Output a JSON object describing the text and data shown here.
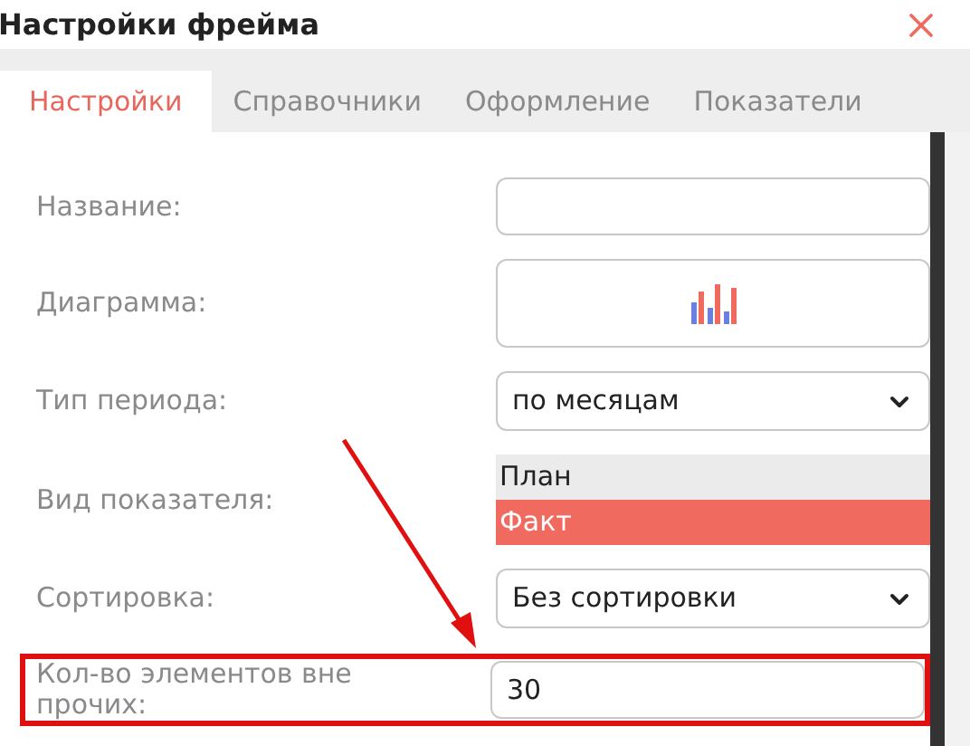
{
  "window": {
    "title": "Настройки фрейма"
  },
  "tabs": [
    {
      "label": "Настройки",
      "selected": true
    },
    {
      "label": "Справочники",
      "selected": false
    },
    {
      "label": "Оформление",
      "selected": false
    },
    {
      "label": "Показатели",
      "selected": false
    }
  ],
  "fields": [
    {
      "kind": "text",
      "label": "Название:",
      "highlighted": false
    },
    {
      "kind": "chart",
      "label": "Диаграмма:",
      "highlighted": false
    },
    {
      "kind": "select",
      "label": "Тип периода:",
      "value": "по месяцам",
      "highlighted": false
    },
    {
      "kind": "listbox",
      "label": "Вид показателя:",
      "options": [
        {
          "label": "План",
          "selected": false
        },
        {
          "label": "Факт",
          "selected": true
        }
      ],
      "highlighted": false
    },
    {
      "kind": "select",
      "label": "Сортировка:",
      "value": "Без сортировки",
      "highlighted": false
    },
    {
      "kind": "text",
      "label": "Кол-во элементов вне прочих:",
      "value": "30",
      "highlighted": true
    }
  ]
}
